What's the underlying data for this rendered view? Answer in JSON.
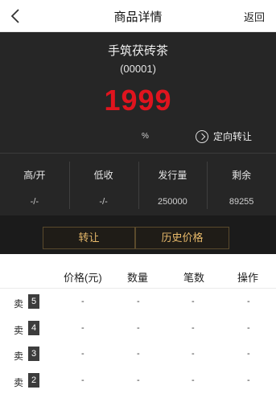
{
  "nav": {
    "title": "商品详情",
    "return_label": "返回"
  },
  "product": {
    "name": "手筑茯砖茶",
    "code": "(00001)",
    "price": "1999",
    "percent": "%",
    "transfer_label": "定向转让"
  },
  "stats": [
    {
      "label": "高/开",
      "value": "-/-"
    },
    {
      "label": "低收",
      "value": "-/-"
    },
    {
      "label": "发行量",
      "value": "250000"
    },
    {
      "label": "剩余",
      "value": "89255"
    }
  ],
  "actions": {
    "transfer": "转让",
    "history": "历史价格"
  },
  "table": {
    "headers": [
      "价格(元)",
      "数量",
      "笔数",
      "操作"
    ],
    "rows": [
      {
        "side": "卖",
        "level": "5",
        "price": "-",
        "qty": "-",
        "count": "-",
        "op": "-"
      },
      {
        "side": "卖",
        "level": "4",
        "price": "-",
        "qty": "-",
        "count": "-",
        "op": "-"
      },
      {
        "side": "卖",
        "level": "3",
        "price": "-",
        "qty": "-",
        "count": "-",
        "op": "-"
      },
      {
        "side": "卖",
        "level": "2",
        "price": "-",
        "qty": "-",
        "count": "-",
        "op": "-"
      }
    ]
  },
  "colors": {
    "price": "#e0141e",
    "panel": "#262626",
    "accent": "#e7b96a"
  }
}
